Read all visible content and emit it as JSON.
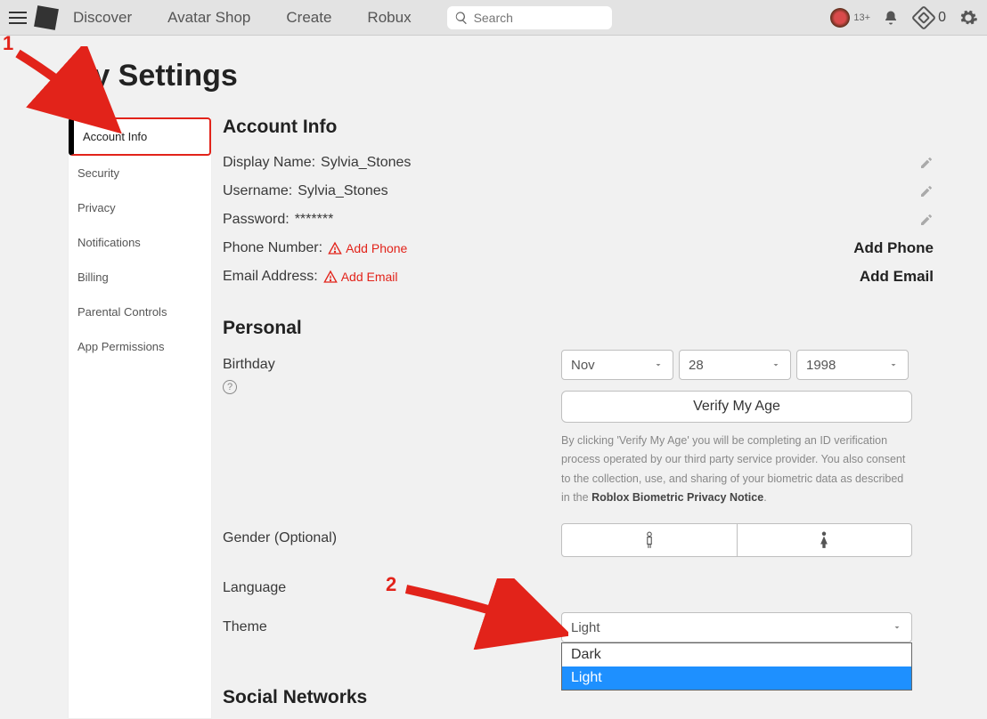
{
  "nav": {
    "links": [
      "Discover",
      "Avatar Shop",
      "Create",
      "Robux"
    ],
    "search_placeholder": "Search",
    "age_label": "13+",
    "robux_count": "0"
  },
  "page": {
    "title": "My Settings"
  },
  "sidebar": {
    "items": [
      "Account Info",
      "Security",
      "Privacy",
      "Notifications",
      "Billing",
      "Parental Controls",
      "App Permissions"
    ]
  },
  "account": {
    "heading": "Account Info",
    "display_name_label": "Display Name:",
    "display_name_value": "Sylvia_Stones",
    "username_label": "Username:",
    "username_value": "Sylvia_Stones",
    "password_label": "Password:",
    "password_value": "*******",
    "phone_label": "Phone Number:",
    "phone_link": "Add Phone",
    "phone_action": "Add Phone",
    "email_label": "Email Address:",
    "email_link": "Add Email",
    "email_action": "Add Email"
  },
  "personal": {
    "heading": "Personal",
    "birthday_label": "Birthday",
    "birthday_month": "Nov",
    "birthday_day": "28",
    "birthday_year": "1998",
    "verify_button": "Verify My Age",
    "disclaimer_text": "By clicking 'Verify My Age' you will be completing an ID verification process operated by our third party service provider. You also consent to the collection, use, and sharing of your biometric data as described in the ",
    "disclaimer_link": "Roblox Biometric Privacy Notice",
    "gender_label": "Gender (Optional)",
    "language_label": "Language",
    "theme_label": "Theme",
    "theme_value": "Light",
    "theme_options": [
      "Dark",
      "Light"
    ]
  },
  "social": {
    "heading": "Social Networks"
  },
  "annotations": {
    "one": "1",
    "two": "2"
  }
}
